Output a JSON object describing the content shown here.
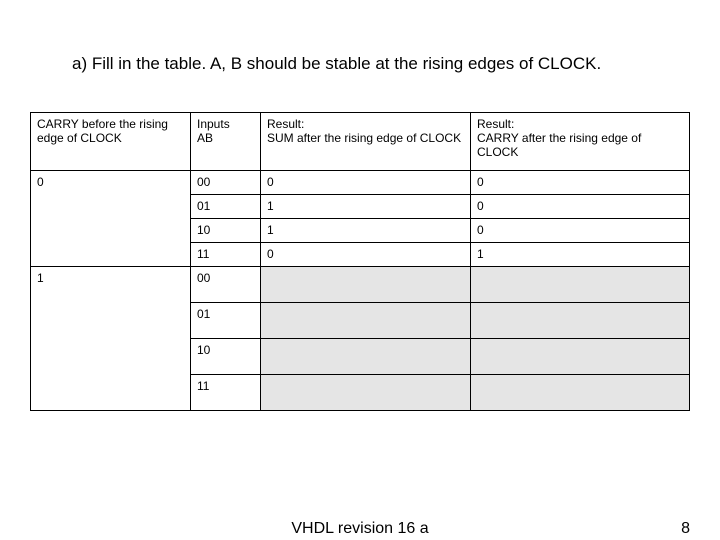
{
  "title": "a) Fill in the table. A, B should be stable at the rising edges of CLOCK.",
  "headers": {
    "carry_before_l1": "CARRY before the rising",
    "carry_before_l2": "edge of CLOCK",
    "inputs_l1": "Inputs",
    "inputs_l2": "AB",
    "sum_l1": "Result:",
    "sum_l2": "SUM after the rising edge of CLOCK",
    "carry_after_l1": "Result:",
    "carry_after_l2": "CARRY after the rising edge of CLOCK"
  },
  "group0_label": "0",
  "group1_label": "1",
  "rows0": [
    {
      "ab": "00",
      "sum": "0",
      "carry": "0"
    },
    {
      "ab": "01",
      "sum": "1",
      "carry": "0"
    },
    {
      "ab": "10",
      "sum": "1",
      "carry": "0"
    },
    {
      "ab": "11",
      "sum": "0",
      "carry": "1"
    }
  ],
  "rows1": [
    {
      "ab": "00"
    },
    {
      "ab": "01"
    },
    {
      "ab": "10"
    },
    {
      "ab": "11"
    }
  ],
  "footer_center": "VHDL revision 16 a",
  "footer_page": "8"
}
